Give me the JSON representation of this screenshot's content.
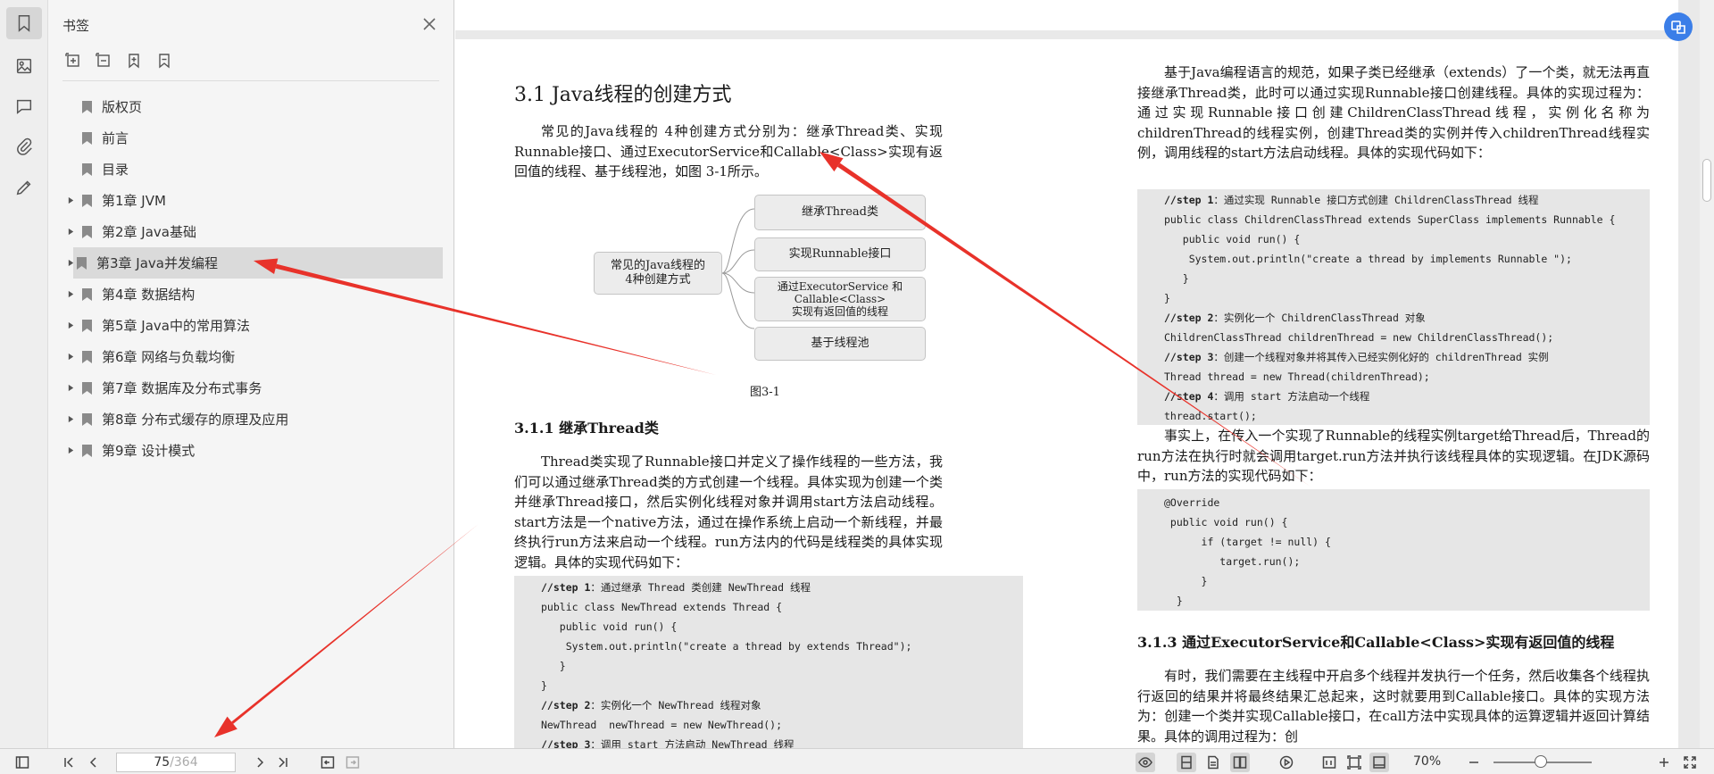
{
  "panel": {
    "title": "书签",
    "items": [
      {
        "label": "版权页",
        "expandable": false
      },
      {
        "label": "前言",
        "expandable": false
      },
      {
        "label": "目录",
        "expandable": false
      },
      {
        "label": "第1章 JVM",
        "expandable": true
      },
      {
        "label": "第2章 Java基础",
        "expandable": true
      },
      {
        "label": "第3章 Java并发编程",
        "expandable": true,
        "selected": true
      },
      {
        "label": "第4章 数据结构",
        "expandable": true
      },
      {
        "label": "第5章 Java中的常用算法",
        "expandable": true
      },
      {
        "label": "第6章 网络与负载均衡",
        "expandable": true
      },
      {
        "label": "第7章 数据库及分布式事务",
        "expandable": true
      },
      {
        "label": "第8章 分布式缓存的原理及应用",
        "expandable": true
      },
      {
        "label": "第9章 设计模式",
        "expandable": true
      }
    ]
  },
  "doc": {
    "left": {
      "heading": "3.1 Java线程的创建方式",
      "intro": "常见的Java线程的 4种创建方式分别为：继承Thread类、实现Runnable接口、通过ExecutorService和Callable<Class>实现有返回值的线程、基于线程池，如图 3-1所示。",
      "diagram": {
        "root": "常见的Java线程的\n4种创建方式",
        "children": [
          "继承Thread类",
          "实现Runnable接口",
          "通过ExecutorService 和\nCallable<Class>\n实现有返回值的线程",
          "基于线程池"
        ],
        "caption": "图3-1"
      },
      "sub_heading": "3.1.1 继承Thread类",
      "para": "Thread类实现了Runnable接口并定义了操作线程的一些方法，我们可以通过继承Thread类的方式创建一个线程。具体实现为创建一个类并继承Thread接口，然后实例化线程对象并调用start方法启动线程。start方法是一个native方法，通过在操作系统上启动一个新线程，并最终执行run方法来启动一个线程。run方法内的代码是线程类的具体实现逻辑。具体的实现代码如下：",
      "code": [
        {
          "bold": "//step 1",
          "text": "：通过继承 Thread 类创建 NewThread 线程"
        },
        {
          "bold": "",
          "text": "public class NewThread extends Thread {"
        },
        {
          "bold": "",
          "text": "   public void run() {"
        },
        {
          "bold": "",
          "text": "    System.out.println(\"create a thread by extends Thread\");"
        },
        {
          "bold": "",
          "text": "   }"
        },
        {
          "bold": "",
          "text": "}"
        },
        {
          "bold": "//step 2",
          "text": "：实例化一个 NewThread 线程对象"
        },
        {
          "bold": "",
          "text": "NewThread  newThread = new NewThread();"
        },
        {
          "bold": "//step 3",
          "text": "：调用 start 方法启动 NewThread 线程"
        }
      ]
    },
    "right": {
      "para1": "基于Java编程语言的规范，如果子类已经继承（extends）了一个类，就无法再直接继承Thread类，此时可以通过实现Runnable接口创建线程。具体的实现过程为：通过实现Runnable接口创建ChildrenClassThread线程，实例化名称为childrenThread的线程实例，创建Thread类的实例并传入childrenThread线程实例，调用线程的start方法启动线程。具体的实现代码如下：",
      "code1": [
        {
          "bold": "//step 1",
          "text": "：通过实现 Runnable 接口方式创建 ChildrenClassThread 线程"
        },
        {
          "bold": "",
          "text": "public class ChildrenClassThread extends SuperClass implements Runnable {"
        },
        {
          "bold": "",
          "text": "   public void run() {"
        },
        {
          "bold": "",
          "text": "    System.out.println(\"create a thread by implements Runnable \");"
        },
        {
          "bold": "",
          "text": "   }"
        },
        {
          "bold": "",
          "text": "}"
        },
        {
          "bold": "//step 2",
          "text": "：实例化一个 ChildrenClassThread 对象"
        },
        {
          "bold": "",
          "text": "ChildrenClassThread childrenThread = new ChildrenClassThread();"
        },
        {
          "bold": "//step 3",
          "text": "：创建一个线程对象并将其传入已经实例化好的 childrenThread 实例"
        },
        {
          "bold": "",
          "text": "Thread thread = new Thread(childrenThread);"
        },
        {
          "bold": "//step 4",
          "text": "：调用 start 方法启动一个线程"
        },
        {
          "bold": "",
          "text": "thread.start();"
        }
      ],
      "para2": "事实上，在传入一个实现了Runnable的线程实例target给Thread后，Thread的run方法在执行时就会调用target.run方法并执行该线程具体的实现逻辑。在JDK源码中，run方法的实现代码如下：",
      "code2": [
        {
          "bold": "",
          "text": "@Override"
        },
        {
          "bold": "",
          "text": " public void run() {"
        },
        {
          "bold": "",
          "text": "      if (target != null) {"
        },
        {
          "bold": "",
          "text": "         target.run();"
        },
        {
          "bold": "",
          "text": "      }"
        },
        {
          "bold": "",
          "text": "  }"
        }
      ],
      "sub_heading": "3.1.3 通过ExecutorService和Callable<Class>实现有返回值的线程",
      "para3": "有时，我们需要在主线程中开启多个线程并发执行一个任务，然后收集各个线程执行返回的结果并将最终结果汇总起来，这时就要用到Callable接口。具体的实现方法为：创建一个类并实现Callable接口，在call方法中实现具体的运算逻辑并返回计算结果。具体的调用过程为：创"
    }
  },
  "status": {
    "page_current": "75",
    "page_total": "/364",
    "zoom": "70%"
  },
  "colors": {
    "annotation_arrow": "#e8322a",
    "accent": "#3b7ee8"
  }
}
